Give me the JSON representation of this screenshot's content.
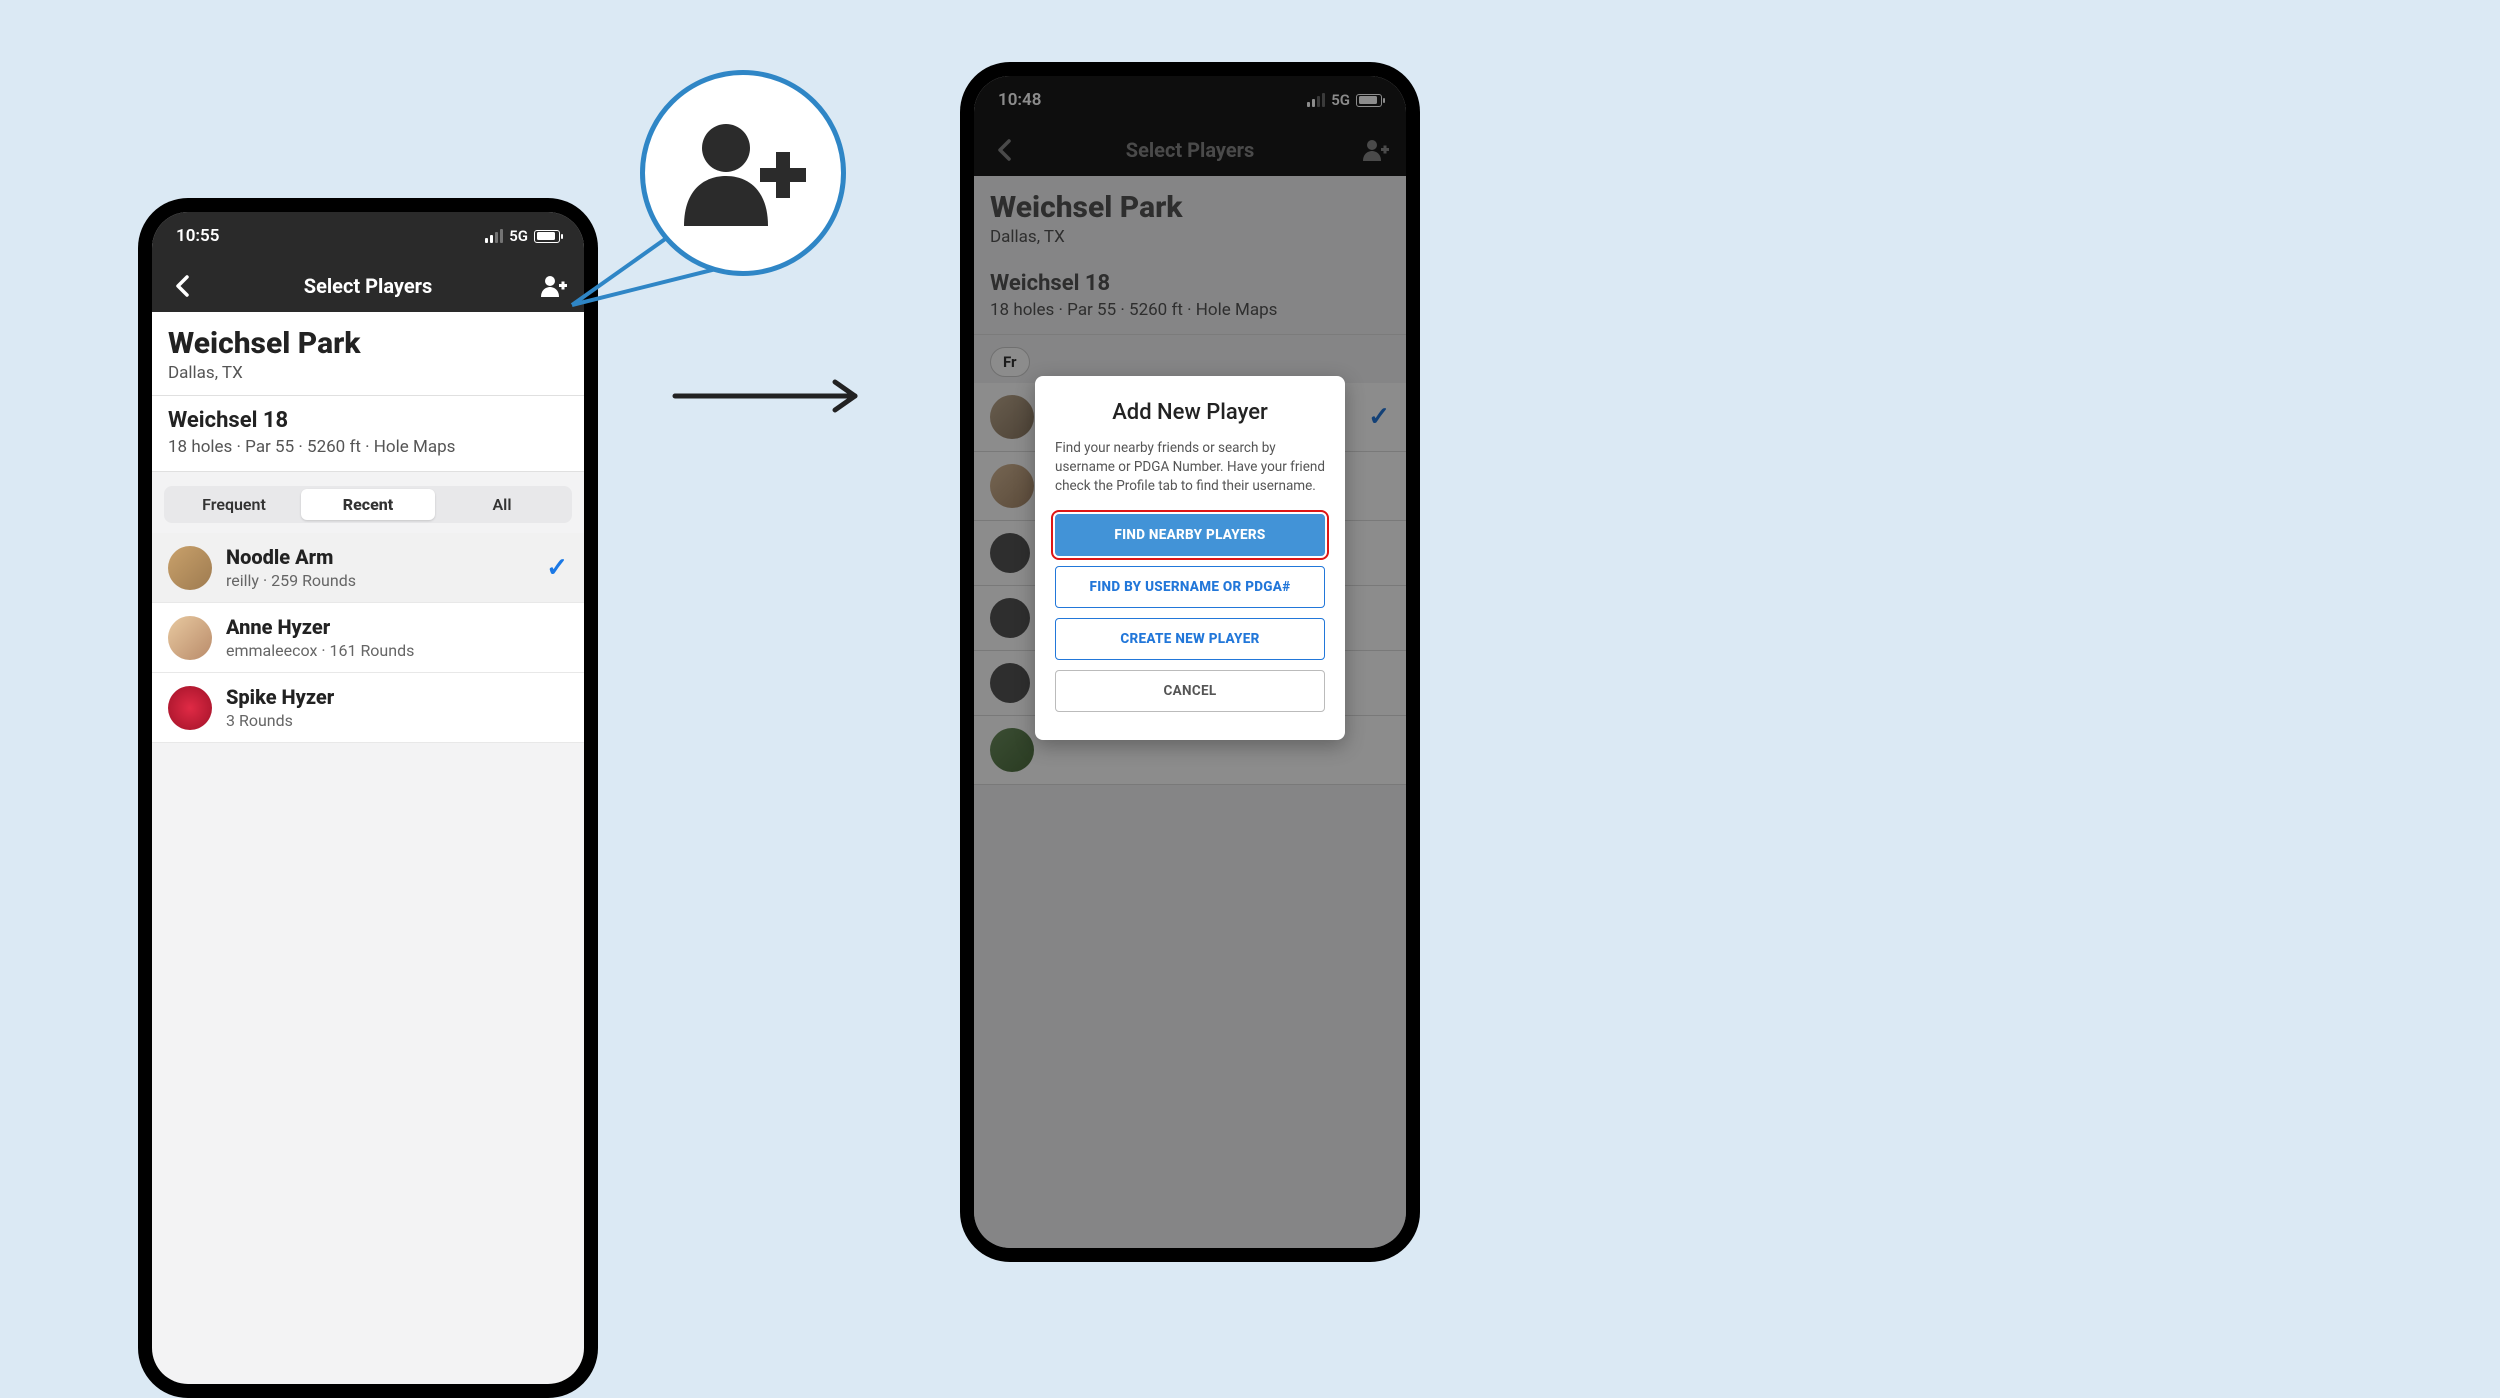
{
  "left": {
    "status": {
      "time": "10:55",
      "net": "5G"
    },
    "nav": {
      "title": "Select Players"
    },
    "course": {
      "name": "Weichsel Park",
      "location": "Dallas, TX"
    },
    "layout": {
      "name": "Weichsel 18",
      "meta": "18 holes  ·  Par 55  ·  5260 ft  ·  Hole Maps"
    },
    "tabs": {
      "frequent": "Frequent",
      "recent": "Recent",
      "all": "All",
      "active": "recent"
    },
    "players": [
      {
        "name": "Noodle Arm",
        "meta": "reilly  ·  259 Rounds",
        "selected": true
      },
      {
        "name": "Anne Hyzer",
        "meta": "emmaleecox  ·  161 Rounds",
        "selected": false
      },
      {
        "name": "Spike Hyzer",
        "meta": "3 Rounds",
        "selected": false
      }
    ]
  },
  "right": {
    "status": {
      "time": "10:48",
      "net": "5G"
    },
    "nav": {
      "title": "Select Players"
    },
    "course": {
      "name": "Weichsel Park",
      "location": "Dallas, TX"
    },
    "layout": {
      "name": "Weichsel 18",
      "meta": "18 holes  ·  Par 55  ·  5260 ft  ·  Hole Maps"
    },
    "pill": "Fr",
    "modal": {
      "title": "Add New Player",
      "desc": "Find your nearby friends or search by username or PDGA Number. Have your friend check the Profile tab to find their username.",
      "buttons": {
        "find_nearby": "FIND NEARBY PLAYERS",
        "find_username": "FIND BY USERNAME OR PDGA#",
        "create": "CREATE NEW PLAYER",
        "cancel": "CANCEL"
      }
    }
  },
  "callout_icon": "person-add-icon"
}
